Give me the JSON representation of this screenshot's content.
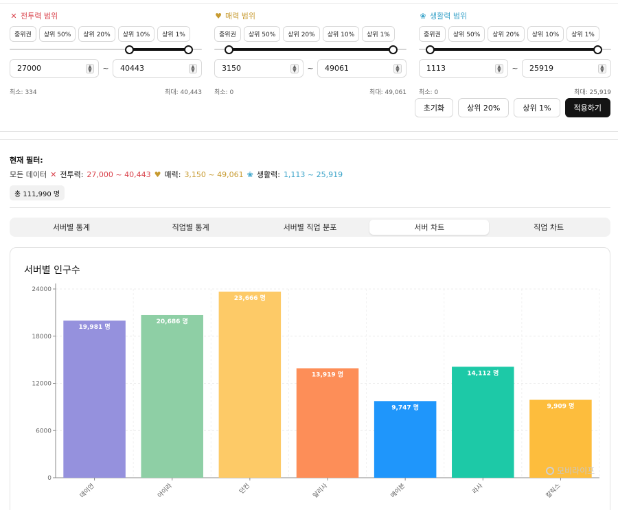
{
  "ranges": [
    {
      "id": "combat",
      "title": "전투력 범위",
      "icon": "crossed-swords-icon",
      "icon_glyph": "✕",
      "color": "#d9414a",
      "presets": [
        "중위권",
        "상위 50%",
        "상위 20%",
        "상위 10%",
        "상위 1%"
      ],
      "low_value": "27000",
      "high_value": "40443",
      "min_text": "최소: 334",
      "max_text": "최대: 40,443",
      "low_fraction": 0.66,
      "high_fraction": 1.0
    },
    {
      "id": "charm",
      "title": "매력 범위",
      "icon": "heart-hand-icon",
      "icon_glyph": "♥",
      "color": "#c79a2f",
      "presets": [
        "중위권",
        "상위 50%",
        "상위 20%",
        "상위 10%",
        "상위 1%"
      ],
      "low_value": "3150",
      "high_value": "49061",
      "min_text": "최소: 0",
      "max_text": "최대: 49,061",
      "low_fraction": 0.06,
      "high_fraction": 1.0
    },
    {
      "id": "life",
      "title": "생활력 범위",
      "icon": "leaf-icon",
      "icon_glyph": "❀",
      "color": "#3aa3c9",
      "presets": [
        "중위권",
        "상위 50%",
        "상위 20%",
        "상위 10%",
        "상위 1%"
      ],
      "low_value": "1113",
      "high_value": "25919",
      "min_text": "최소: 0",
      "max_text": "최대: 25,919",
      "low_fraction": 0.04,
      "high_fraction": 1.0
    }
  ],
  "actions": {
    "reset": "초기화",
    "top20": "상위 20%",
    "top1": "상위 1%",
    "apply": "적용하기"
  },
  "filter": {
    "label": "현재 필터:",
    "all_data": "모든 데이터",
    "combat_label": "전투력:",
    "combat_value": "27,000 ~ 40,443",
    "charm_label": "매력:",
    "charm_value": "3,150 ~ 49,061",
    "life_label": "생활력:",
    "life_value": "1,113 ~ 25,919",
    "total": "총 111,990 명"
  },
  "tabs": [
    "서버별 통계",
    "직업별 통계",
    "서버별 직업 분포",
    "서버 차트",
    "직업 차트"
  ],
  "active_tab": 3,
  "card": {
    "title": "서버별 인구수",
    "watermark": "모비라이프"
  },
  "chart_data": {
    "type": "bar",
    "title": "서버별 인구수",
    "categories": [
      "데이안",
      "아이라",
      "던컨",
      "알리사",
      "메이븐",
      "라사",
      "칼릭스"
    ],
    "values": [
      19981,
      20686,
      23666,
      13919,
      9747,
      14112,
      9909
    ],
    "value_labels": [
      "19,981 명",
      "20,686 명",
      "23,666 명",
      "13,919 명",
      "9,747 명",
      "14,112 명",
      "9,909 명"
    ],
    "colors": [
      "#9591dd",
      "#8ecfa5",
      "#fdca67",
      "#fd8e58",
      "#1f96fb",
      "#1dc9a7",
      "#fdbd3d"
    ],
    "y_ticks": [
      0,
      6000,
      12000,
      18000,
      24000
    ],
    "ylim": [
      0,
      24000
    ],
    "grid": true,
    "xlabel": "",
    "ylabel": ""
  }
}
